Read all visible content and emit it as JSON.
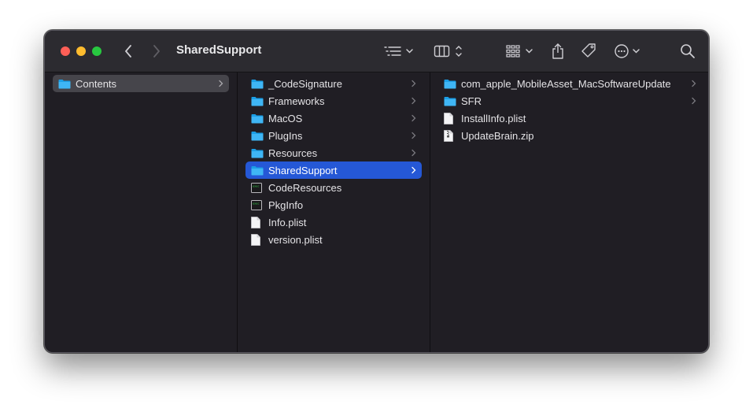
{
  "window": {
    "title": "SharedSupport"
  },
  "columns": {
    "col1": [
      {
        "label": "Contents",
        "kind": "folder",
        "chevron": true,
        "selected": "gray"
      }
    ],
    "col2": [
      {
        "label": "_CodeSignature",
        "kind": "folder",
        "chevron": true
      },
      {
        "label": "Frameworks",
        "kind": "folder",
        "chevron": true
      },
      {
        "label": "MacOS",
        "kind": "folder",
        "chevron": true
      },
      {
        "label": "PlugIns",
        "kind": "folder",
        "chevron": true
      },
      {
        "label": "Resources",
        "kind": "folder",
        "chevron": true
      },
      {
        "label": "SharedSupport",
        "kind": "folder",
        "chevron": true,
        "selected": "blue"
      },
      {
        "label": "CodeResources",
        "kind": "exec"
      },
      {
        "label": "PkgInfo",
        "kind": "exec"
      },
      {
        "label": "Info.plist",
        "kind": "doc"
      },
      {
        "label": "version.plist",
        "kind": "doc"
      }
    ],
    "col3": [
      {
        "label": "com_apple_MobileAsset_MacSoftwareUpdate",
        "kind": "folder",
        "chevron": true
      },
      {
        "label": "SFR",
        "kind": "folder",
        "chevron": true
      },
      {
        "label": "InstallInfo.plist",
        "kind": "doc"
      },
      {
        "label": "UpdateBrain.zip",
        "kind": "zip"
      }
    ]
  },
  "colors": {
    "folder": "#1aa9f2",
    "selection": "#2558d6",
    "background": "#201e24"
  }
}
